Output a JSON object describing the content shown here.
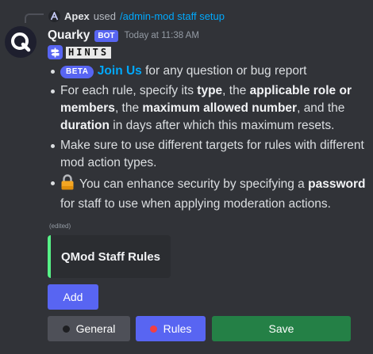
{
  "reply": {
    "user_name": "Apex",
    "used_text": "used",
    "command": "/admin-mod staff setup"
  },
  "message": {
    "author": "Quarky",
    "bot_tag": "BOT",
    "timestamp": "Today at 11:38 AM",
    "hints_label": "HINTS",
    "edited_label": "(edited)"
  },
  "bullets": {
    "b1": {
      "badge": "BETA",
      "link": "Join Us",
      "text": " for any question or bug report"
    },
    "b2": {
      "t1": "For each rule, specify its ",
      "k1": "type",
      "t2": ", the ",
      "k2": "applicable role or members",
      "t3": ", the ",
      "k3": "maximum allowed number",
      "t4": ", and the ",
      "k4": "duration",
      "t5": " in days after which this maximum resets."
    },
    "b3": {
      "text": "Make sure to use different targets for rules with different mod action types."
    },
    "b4": {
      "t1": " You can enhance security by specifying a ",
      "k1": "password",
      "t2": " for staff to use when applying moderation actions."
    }
  },
  "embed": {
    "title": "QMod Staff Rules",
    "accent_color": "#57f287"
  },
  "buttons": {
    "add": "Add",
    "general": "General",
    "rules": "Rules",
    "save": "Save"
  },
  "icons": {
    "avatar": "quarky-q-logo-icon",
    "reply_avatar": "apex-a-icon",
    "hint": "signpost-icon",
    "lock": "lock-icon",
    "general_dot": "dark-dot-icon",
    "rules_dot": "red-dot-icon"
  },
  "colors": {
    "blurple": "#5865f2",
    "link": "#00a8fc",
    "green": "#248046",
    "gray_button": "#4e5058",
    "red_dot": "#f23f43"
  }
}
